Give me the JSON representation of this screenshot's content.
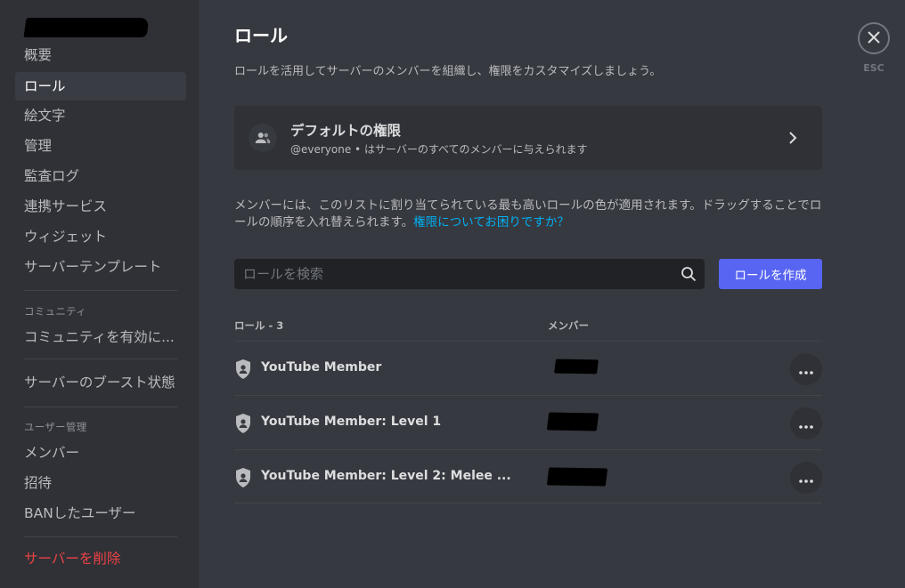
{
  "sidebar": {
    "items": [
      {
        "label": "概要"
      },
      {
        "label": "ロール",
        "active": true
      },
      {
        "label": "絵文字"
      },
      {
        "label": "管理"
      },
      {
        "label": "監査ログ"
      },
      {
        "label": "連携サービス"
      },
      {
        "label": "ウィジェット"
      },
      {
        "label": "サーバーテンプレート"
      }
    ],
    "community_header": "コミュニティ",
    "community_item": "コミュニティを有効に...",
    "boost_item": "サーバーのブースト状態",
    "user_header": "ユーザー管理",
    "user_items": [
      {
        "label": "メンバー"
      },
      {
        "label": "招待"
      },
      {
        "label": "BANしたユーザー"
      }
    ],
    "delete_server": "サーバーを削除"
  },
  "main": {
    "title": "ロール",
    "description": "ロールを活用してサーバーのメンバーを組織し、権限をカスタマイズしましょう。",
    "default_card": {
      "title": "デフォルトの権限",
      "subtitle": "@everyone • はサーバーのすべてのメンバーに与えられます"
    },
    "info_text": "メンバーには、このリストに割り当てられている最も高いロールの色が適用されます。ドラッグすることでロールの順序を入れ替えられます。",
    "info_link": "権限についてお困りですか？",
    "search_placeholder": "ロールを検索",
    "create_button": "ロールを作成",
    "table": {
      "col_roles": "ロール - 3",
      "col_members": "メンバー",
      "rows": [
        {
          "name": "YouTube Member"
        },
        {
          "name": "YouTube Member: Level 1"
        },
        {
          "name": "YouTube Member: Level 2: Melee ..."
        }
      ]
    }
  },
  "close": {
    "label": "ESC"
  },
  "colors": {
    "accent": "#5865f2",
    "danger": "#ed4245",
    "link": "#00aff4"
  }
}
